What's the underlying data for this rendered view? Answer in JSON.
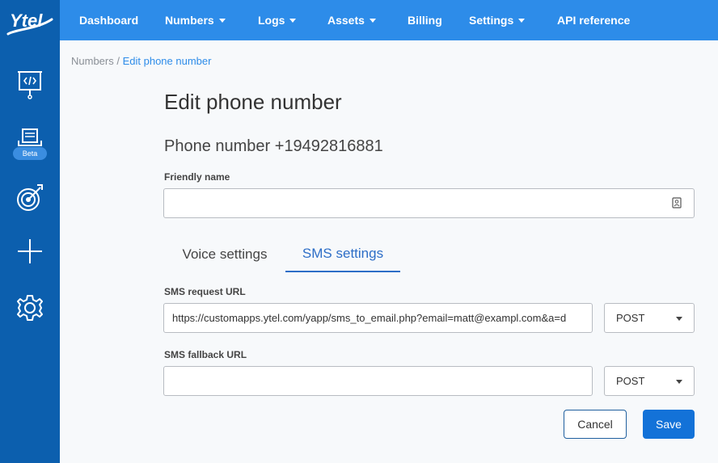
{
  "brand": {
    "logo_text": "Ytel"
  },
  "sidebar": {
    "items": [
      {
        "icon": "code-presentation-icon"
      },
      {
        "icon": "document-feed-icon",
        "badge": "Beta"
      },
      {
        "icon": "target-icon"
      },
      {
        "icon": "plus-icon"
      },
      {
        "icon": "gear-icon"
      }
    ]
  },
  "nav": {
    "items": [
      {
        "label": "Dashboard"
      },
      {
        "label": "Numbers"
      },
      {
        "label": "Logs"
      },
      {
        "label": "Assets"
      },
      {
        "label": "Billing"
      },
      {
        "label": "Settings"
      },
      {
        "label": "API reference"
      }
    ]
  },
  "breadcrumb": {
    "parent": "Numbers",
    "separator": " / ",
    "current": "Edit phone number"
  },
  "page": {
    "title": "Edit phone number",
    "phone_heading": "Phone number +19492816881"
  },
  "form": {
    "friendly_name": {
      "label": "Friendly name",
      "value": ""
    },
    "tabs": [
      {
        "label": "Voice settings",
        "active": false
      },
      {
        "label": "SMS settings",
        "active": true
      }
    ],
    "sms_request_url": {
      "label": "SMS request URL",
      "value": "https://customapps.ytel.com/yapp/sms_to_email.php?email=matt@exampl.com&a=d",
      "method": "POST"
    },
    "sms_fallback_url": {
      "label": "SMS fallback URL",
      "value": "",
      "method": "POST"
    },
    "cancel_label": "Cancel",
    "save_label": "Save"
  },
  "colors": {
    "sidebar": "#0c5fae",
    "topbar": "#2d8ce9",
    "primary": "#1372d8",
    "active_tab": "#2d6ec7"
  }
}
